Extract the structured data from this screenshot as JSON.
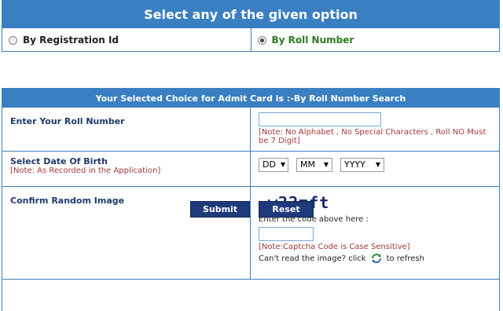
{
  "option_box": {
    "title": "Select any of the given option",
    "option1_label": "By Registration Id",
    "option2_label": "By Roll Number",
    "selected": "By Roll Number"
  },
  "form": {
    "title": "Your Selected Choice for Admit Card is :-By Roll Number Search",
    "roll": {
      "label": "Enter Your Roll Number",
      "value": "",
      "note": "[Note: No Alphabet , No Special Characters , Roll NO Must be 7 Digit]"
    },
    "dob": {
      "label": "Select Date Of Birth",
      "note": "[Note: As Recorded in the Application]",
      "day": "DD",
      "month": "MM",
      "year": "YYYY"
    },
    "captcha": {
      "label": "Confirm Random Image",
      "image_text": "w22mft",
      "enter_text": "Enter the code above here :",
      "value": "",
      "note": "[Note:Captcha Code is Case Sensitive]",
      "cant_read": "Can't read the image? click",
      "refresh_text": "to refresh",
      "refresh_icon": "refresh-icon"
    },
    "submit_label": "Submit",
    "reset_label": "Reset"
  },
  "colors": {
    "header_blue": "#3a7fc1",
    "button_navy": "#1f3a7a",
    "note_red": "#a03a3a",
    "selected_green": "#2d7a1f"
  }
}
